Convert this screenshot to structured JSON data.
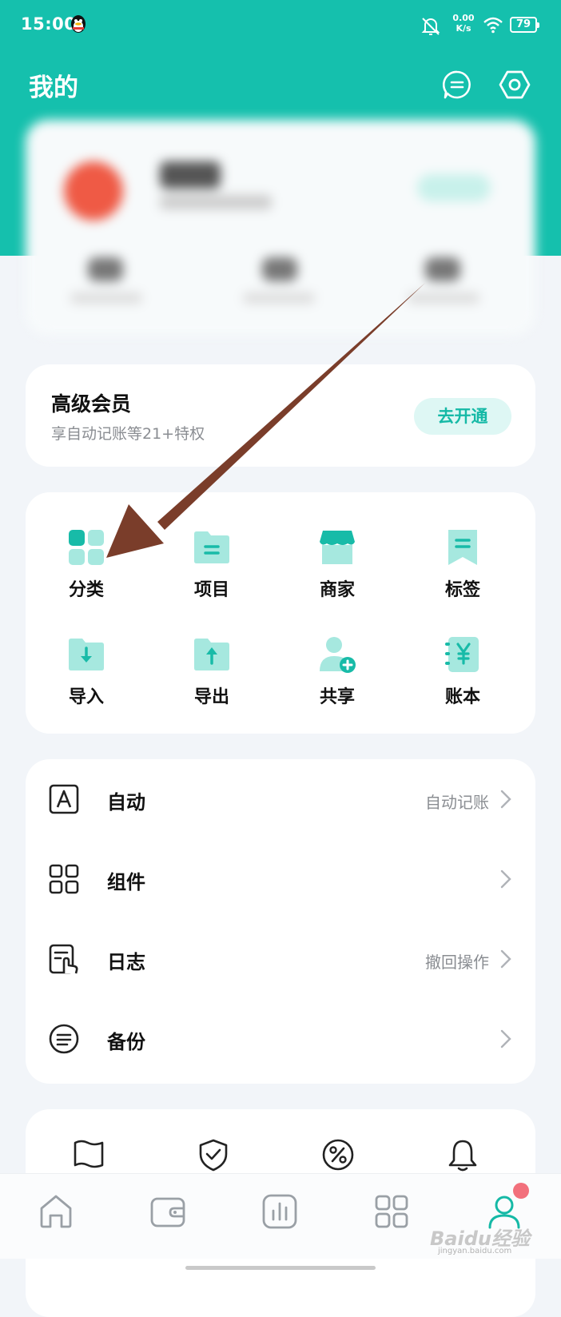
{
  "status_bar": {
    "time": "15:00",
    "net_speed_value": "0.00",
    "net_speed_unit": "K/s",
    "battery": "79"
  },
  "header": {
    "title": "我的"
  },
  "vip": {
    "title": "高级会员",
    "subtitle": "享自动记账等21+特权",
    "button": "去开通"
  },
  "grid": {
    "items": [
      {
        "label": "分类",
        "icon": "category-icon"
      },
      {
        "label": "项目",
        "icon": "project-folder-icon"
      },
      {
        "label": "商家",
        "icon": "merchant-store-icon"
      },
      {
        "label": "标签",
        "icon": "tag-bookmark-icon"
      },
      {
        "label": "导入",
        "icon": "import-folder-icon"
      },
      {
        "label": "导出",
        "icon": "export-folder-icon"
      },
      {
        "label": "共享",
        "icon": "share-user-icon"
      },
      {
        "label": "账本",
        "icon": "ledger-book-icon"
      }
    ]
  },
  "list": {
    "items": [
      {
        "label": "自动",
        "value": "自动记账",
        "icon": "auto-a-icon"
      },
      {
        "label": "组件",
        "value": "",
        "icon": "widgets-icon"
      },
      {
        "label": "日志",
        "value": "撤回操作",
        "icon": "log-icon"
      },
      {
        "label": "备份",
        "value": "",
        "icon": "backup-icon"
      }
    ]
  },
  "more": {
    "icons": [
      "flag-icon",
      "shield-check-icon",
      "percent-icon",
      "bell-icon"
    ]
  },
  "bottom_nav": {
    "items": [
      "home-icon",
      "wallet-icon",
      "chart-icon",
      "apps-icon",
      "profile-icon"
    ],
    "active": "profile-icon"
  },
  "watermark": {
    "text": "Baidu经验",
    "sub": "jingyan.baidu.com"
  },
  "colors": {
    "accent": "#15c0ad",
    "annotation_arrow": "#7a3d2a",
    "badge": "#f2707c"
  }
}
